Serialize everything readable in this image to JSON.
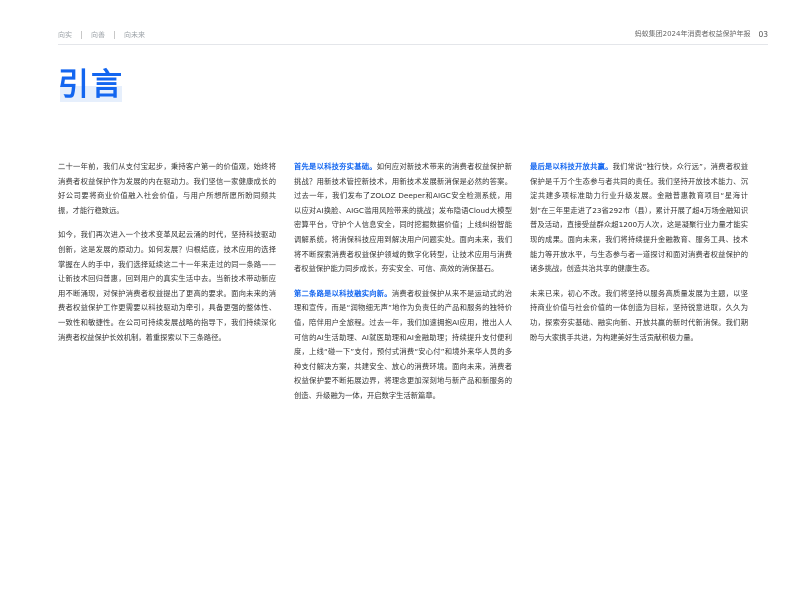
{
  "header": {
    "nav": [
      "向实",
      "向善",
      "向未来"
    ],
    "report_title": "蚂蚁集团2024年消费者权益保护年报",
    "page_number": "03"
  },
  "title": "引言",
  "column1": {
    "p1": "二十一年前，我们从支付宝起步，秉持客户第一的价值观，始终将消费者权益保护作为发展的内在驱动力。我们坚信一家健康成长的好公司要将商业价值融入社会价值，与用户所想所愿所盼同频共振，才能行稳致远。",
    "p2": "如今，我们再次进入一个技术变革风起云涌的时代，坚持科技驱动创新，这是发展的原动力。如何发展？归根结底，技术应用的选择掌握在人的手中，我们选择延续这二十一年来走过的同一条路——让新技术回归普惠，回到用户的真实生活中去。当新技术带动新应用不断涌现，对保护消费者权益提出了更高的要求。面向未来的消费者权益保护工作更需要以科技驱动为牵引，具备更强的整体性、一致性和敏捷性。在公司可持续发展战略的指导下，我们持续深化消费者权益保护长效机制，着重探索以下三条路径。"
  },
  "column2": {
    "p1_lead": "首先是以科技夯实基础。",
    "p1": "如何应对新技术带来的消费者权益保护新挑战？用新技术管控新技术，用新技术发展新消保是必然的答案。过去一年，我们发布了ZOLOZ Deeper和AIGC安全检测系统，用以应对AI换脸、AIGC滥用风险带来的挑战；发布隐语Cloud大模型密算平台，守护个人信息安全，同时挖掘数据价值；上线纠纷智能调解系统，将消保科技应用到解决用户问题实处。面向未来，我们将不断探索消费者权益保护领域的数字化转型，让技术应用与消费者权益保护能力同步成长，夯实安全、可信、高效的消保基石。",
    "p2_lead": "第二条路是以科技融实向新。",
    "p2": "消费者权益保护从来不是运动式的治理和宣传，而是“润物细无声”地作为负责任的产品和服务的独特价值，陪伴用户全旅程。过去一年，我们加速拥抱AI应用，推出人人可信的AI生活助理、AI就医助理和AI金融助理；持续提升支付便利度，上线“碰一下”支付，预付式消费“安心付”和境外来华人员的多种支付解决方案，共建安全、放心的消费环境。面向未来，消费者权益保护要不断拓展边界，将理念更加深刻地与新产品和新服务的创造、升级融为一体，开启数字生活新篇章。"
  },
  "column3": {
    "p1_lead": "最后是以科技开放共赢。",
    "p1": "我们常说“独行快，众行远”，消费者权益保护是千万个生态参与者共同的责任。我们坚持开放技术能力、沉淀共建多项标准助力行业升级发展。金融普惠教育项目“星海计划”在三年里走进了23省292市（县），累计开展了超4万场金融知识普及活动，直接受益群众超1200万人次，这是凝聚行业力量才能实现的成果。面向未来，我们将持续提升金融教育、服务工具、技术能力等开放水平，与生态参与者一道探讨和面对消费者权益保护的诸多挑战，创造共治共享的健康生态。",
    "p2": "未来已来，初心不改。我们将坚持以服务高质量发展为主题，以坚持商业价值与社会价值的一体创造为目标，坚持锐意进取，久久为功，探索夯实基础、融实向新、开放共赢的新时代新消保。我们期盼与大家携手共进，为构建美好生活贡献积极力量。"
  }
}
